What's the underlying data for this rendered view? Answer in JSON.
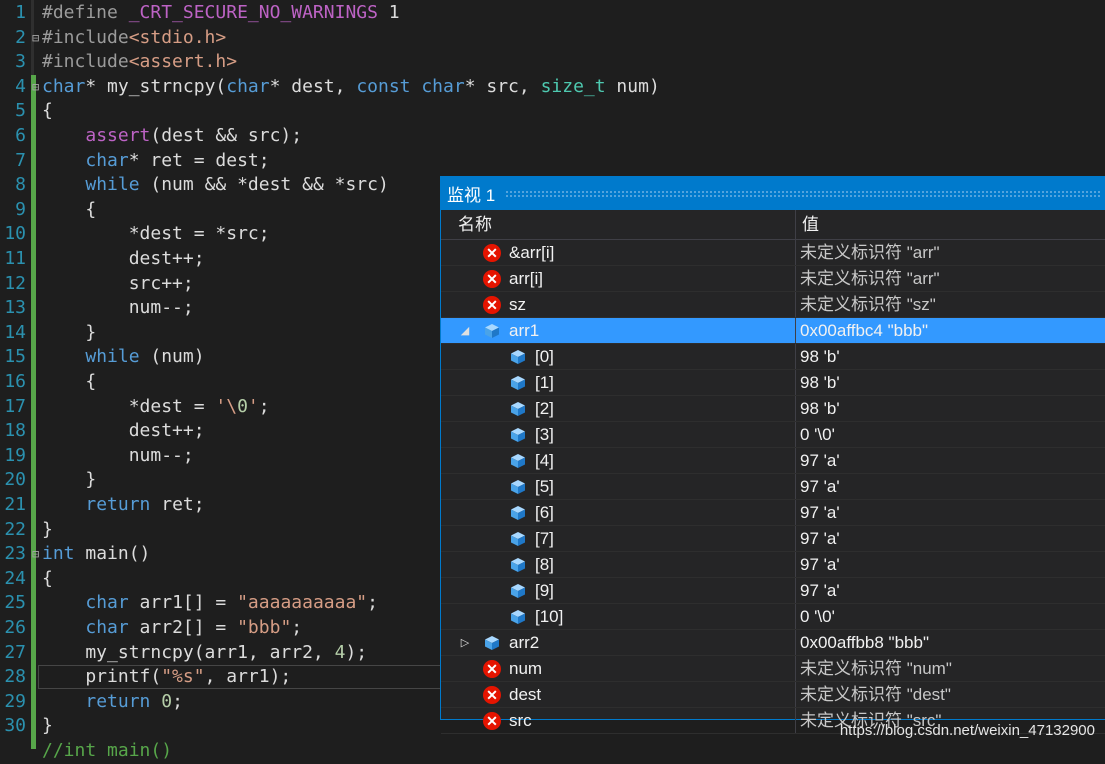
{
  "editor": {
    "line_numbers": [
      "1",
      "2",
      "3",
      "4",
      "5",
      "6",
      "7",
      "8",
      "9",
      "10",
      "11",
      "12",
      "13",
      "14",
      "15",
      "16",
      "17",
      "18",
      "19",
      "20",
      "21",
      "22",
      "23",
      "24",
      "25",
      "26",
      "27",
      "28",
      "29",
      "30"
    ],
    "lines": [
      "#define _CRT_SECURE_NO_WARNINGS 1",
      "#include<stdio.h>",
      "#include<assert.h>",
      "char* my_strncpy(char* dest, const char* src, size_t num)",
      "{",
      "    assert(dest && src);",
      "    char* ret = dest;",
      "    while (num && *dest && *src)",
      "    {",
      "        *dest = *src;",
      "        dest++;",
      "        src++;",
      "        num--;",
      "    }",
      "    while (num)",
      "    {",
      "        *dest = '\\0';",
      "        dest++;",
      "        num--;",
      "    }",
      "    return ret;",
      "}",
      "int main()",
      "{",
      "    char arr1[] = \"aaaaaaaaaa\";",
      "    char arr2[] = \"bbb\";",
      "    my_strncpy(arr1, arr2, 4);",
      "    printf(\"%s\", arr1);",
      "    return 0;",
      "}",
      "//int main()"
    ]
  },
  "watch": {
    "title": "监视 1",
    "col_name": "名称",
    "col_value": "值",
    "rows": [
      {
        "name": "&arr[i]",
        "value": "未定义标识符 \"arr\"",
        "icon": "error-icon"
      },
      {
        "name": "arr[i]",
        "value": "未定义标识符 \"arr\"",
        "icon": "error-icon"
      },
      {
        "name": "sz",
        "value": "未定义标识符 \"sz\"",
        "icon": "error-icon"
      },
      {
        "name": "arr1",
        "value": "0x00affbc4 \"bbb\"",
        "icon": "cube-icon",
        "expanded": true,
        "selected": true
      },
      {
        "name": "[0]",
        "value": "98 'b'",
        "icon": "cube-icon"
      },
      {
        "name": "[1]",
        "value": "98 'b'",
        "icon": "cube-icon"
      },
      {
        "name": "[2]",
        "value": "98 'b'",
        "icon": "cube-icon"
      },
      {
        "name": "[3]",
        "value": "0 '\\0'",
        "icon": "cube-icon"
      },
      {
        "name": "[4]",
        "value": "97 'a'",
        "icon": "cube-icon"
      },
      {
        "name": "[5]",
        "value": "97 'a'",
        "icon": "cube-icon"
      },
      {
        "name": "[6]",
        "value": "97 'a'",
        "icon": "cube-icon"
      },
      {
        "name": "[7]",
        "value": "97 'a'",
        "icon": "cube-icon"
      },
      {
        "name": "[8]",
        "value": "97 'a'",
        "icon": "cube-icon"
      },
      {
        "name": "[9]",
        "value": "97 'a'",
        "icon": "cube-icon"
      },
      {
        "name": "[10]",
        "value": "0 '\\0'",
        "icon": "cube-icon"
      },
      {
        "name": "arr2",
        "value": "0x00affbb8 \"bbb\"",
        "icon": "cube-icon",
        "expanded": false
      },
      {
        "name": "num",
        "value": "未定义标识符 \"num\"",
        "icon": "error-icon"
      },
      {
        "name": "dest",
        "value": "未定义标识符 \"dest\"",
        "icon": "error-icon"
      },
      {
        "name": "src",
        "value": "未定义标识符 \"src\"",
        "icon": "error-icon"
      }
    ]
  },
  "watermark": "https://blog.csdn.net/weixin_47132900",
  "colors": {
    "accent": "#007acc",
    "selection": "#3399ff",
    "error": "#e51400",
    "line_number": "#2b91af",
    "keyword": "#569cd6"
  }
}
